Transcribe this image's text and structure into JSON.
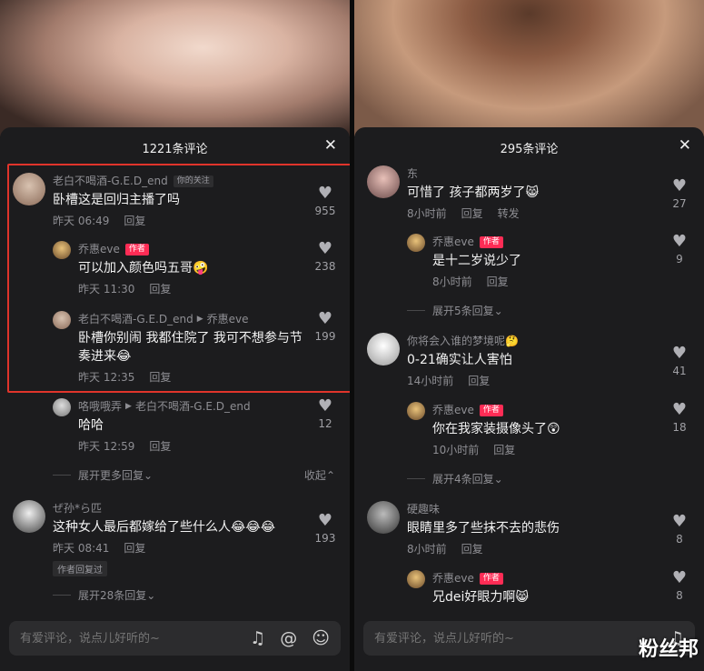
{
  "left": {
    "title": "1221条评论",
    "close": "✕",
    "comments": [
      {
        "name": "老白不喝酒-G.E.D_end",
        "tag": "你的关注",
        "text": "卧槽这是回归主播了吗",
        "time": "昨天 06:49",
        "reply": "回复",
        "likes": "955"
      },
      {
        "name": "乔惠eve",
        "tag": "作者",
        "text": "可以加入颜色吗五哥🤪",
        "time": "昨天 11:30",
        "reply": "回复",
        "likes": "238"
      },
      {
        "name": "老白不喝酒-G.E.D_end",
        "to": "乔惠eve",
        "text": "卧槽你别闹 我都住院了 我可不想参与节奏进来😂",
        "time": "昨天 12:35",
        "reply": "回复",
        "likes": "199"
      },
      {
        "name": "咯哦哦弄",
        "to": "老白不喝酒-G.E.D_end",
        "text": "哈哈",
        "time": "昨天 12:59",
        "reply": "回复",
        "likes": "12"
      },
      {
        "name": "ぜ孙*ら匹",
        "text": "这种女人最后都嫁给了些什么人😂😂😂",
        "time": "昨天 08:41",
        "reply": "回复",
        "likes": "193",
        "badge": "作者回复过"
      }
    ],
    "expand_more": "展开更多回复",
    "collapse": "收起",
    "expand_28": "展开28条回复",
    "input_placeholder": "有爱评论，说点儿好听的~"
  },
  "right": {
    "title": "295条评论",
    "close": "✕",
    "comments": [
      {
        "name": "东",
        "text": "可惜了 孩子都两岁了😸",
        "time": "8小时前",
        "reply": "回复",
        "forward": "转发",
        "likes": "27"
      },
      {
        "name": "乔惠eve",
        "tag": "作者",
        "text": "是十二岁说少了",
        "time": "8小时前",
        "reply": "回复",
        "likes": "9"
      },
      {
        "name": "你将会入谁的梦境呢🤔",
        "text": "0-21确实让人害怕",
        "time": "14小时前",
        "reply": "回复",
        "likes": "41"
      },
      {
        "name": "乔惠eve",
        "tag": "作者",
        "text": "你在我家装摄像头了😲",
        "time": "10小时前",
        "reply": "回复",
        "likes": "18"
      },
      {
        "name": "硬趣味",
        "text": "眼睛里多了些抹不去的悲伤",
        "time": "8小时前",
        "reply": "回复",
        "likes": "8"
      },
      {
        "name": "乔惠eve",
        "tag": "作者",
        "text": "兄dei好眼力啊😸",
        "time": "",
        "reply": "",
        "likes": "8"
      }
    ],
    "expand_5": "展开5条回复",
    "expand_4": "展开4条回复",
    "input_placeholder": "有爱评论，说点儿好听的~"
  },
  "icons": {
    "music": "♫",
    "at": "@",
    "emoji": "☺",
    "heart": "♥",
    "chevron": "⌄",
    "chevron_up": "⌃",
    "play": "▶"
  },
  "watermark": "粉丝邦"
}
